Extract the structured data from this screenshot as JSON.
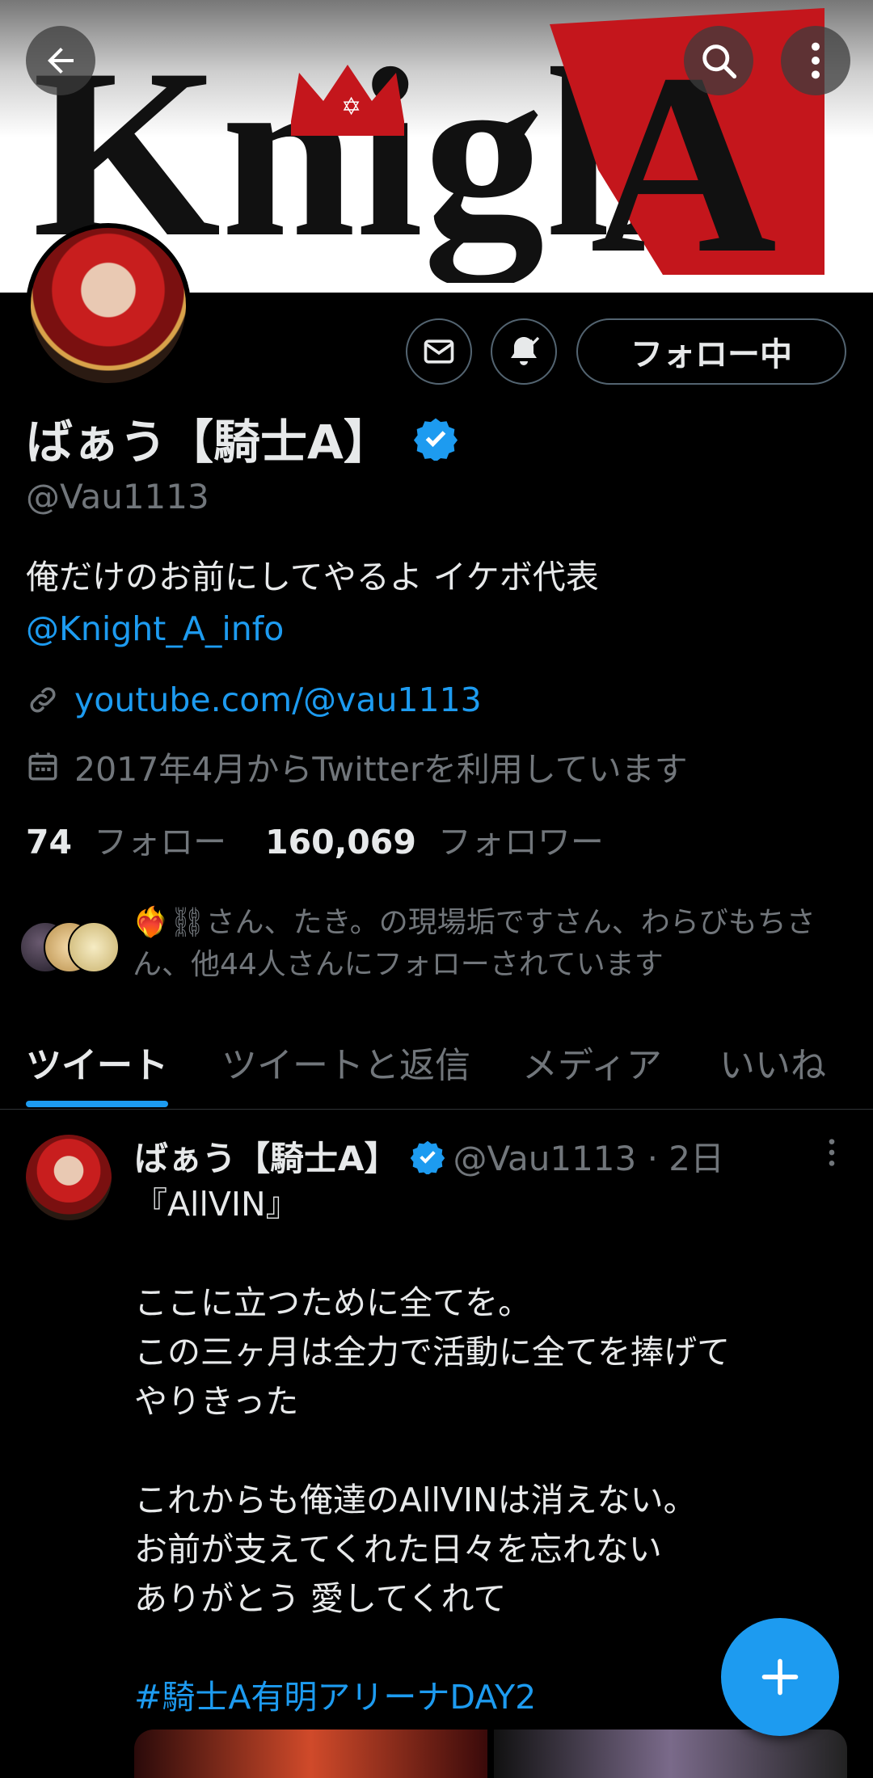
{
  "header": {
    "back_icon": "arrow-left-icon",
    "search_icon": "search-icon",
    "more_icon": "more-vertical-icon",
    "banner_text_left": "Knight",
    "banner_text_right": "A",
    "accent_red": "#c4161c"
  },
  "profile": {
    "name": "ばぁう【騎士A】",
    "handle": "@Vau1113",
    "bio_line1": "俺だけのお前にしてやるよ イケボ代表",
    "bio_mention": "@Knight_A_info",
    "link": "youtube.com/@vau1113",
    "joined": "2017年4月からTwitterを利用しています",
    "follow_button": "フォロー中",
    "following_count": "74",
    "following_label": "フォロー",
    "followers_count": "160,069",
    "followers_label": "フォロワー",
    "followed_by": "❤️‍🔥⛓さん、たき。の現場垢ですさん、わらびもちさん、他44人さんにフォローされています"
  },
  "tabs": [
    {
      "label": "ツイート"
    },
    {
      "label": "ツイートと返信"
    },
    {
      "label": "メディア"
    },
    {
      "label": "いいね"
    }
  ],
  "tweet": {
    "name": "ばぁう【騎士A】",
    "meta": "@Vau1113 · 2日",
    "body": "『AllVIN』\n\nここに立つために全てを。\nこの三ヶ月は全力で活動に全てを捧げて\nやりきった\n\nこれからも俺達のAllVINは消えない。\nお前が支えてくれた日々を忘れない\nありがとう 愛してくれて",
    "hashtag": "#騎士A有明アリーナDAY2"
  },
  "colors": {
    "accent": "#1d9bf0",
    "muted": "#71767b",
    "text": "#e7e9ea",
    "background": "#000000"
  }
}
